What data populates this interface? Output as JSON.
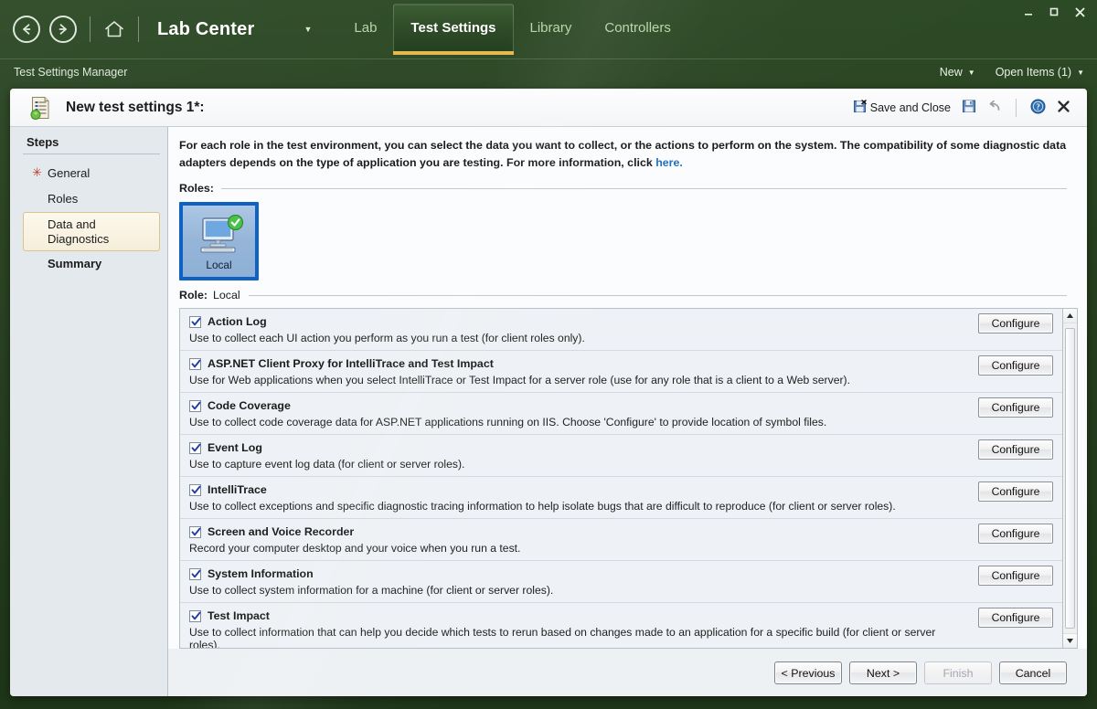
{
  "window": {
    "minimize_label": "minimize",
    "maximize_label": "maximize",
    "close_label": "close"
  },
  "nav": {
    "back_label": "Back",
    "forward_label": "Forward",
    "home_label": "Home",
    "brand": "Lab Center",
    "brand_caret": "▼",
    "tabs": [
      {
        "label": "Lab",
        "active": false
      },
      {
        "label": "Test Settings",
        "active": true
      },
      {
        "label": "Library",
        "active": false
      },
      {
        "label": "Controllers",
        "active": false
      }
    ]
  },
  "subbar": {
    "title": "Test Settings Manager",
    "new_label": "New",
    "open_items_label": "Open Items (1)",
    "caret": "▼"
  },
  "card": {
    "title": "New test settings 1*:",
    "actions": {
      "save_and_close": "Save and Close",
      "save": "Save",
      "undo": "Undo",
      "help": "Help",
      "close": "Close"
    }
  },
  "sidebar": {
    "heading": "Steps",
    "items": [
      {
        "label": "General",
        "required": true,
        "selected": false,
        "bold": false
      },
      {
        "label": "Roles",
        "required": false,
        "selected": false,
        "bold": false
      },
      {
        "label": "Data and Diagnostics",
        "required": false,
        "selected": true,
        "bold": false
      },
      {
        "label": "Summary",
        "required": false,
        "selected": false,
        "bold": true
      }
    ]
  },
  "main": {
    "intro_text": "For each role in the test environment, you can select the data you want to collect, or the actions to perform on the system. The compatibility of some diagnostic data adapters depends on the type of application you are testing. For more information, click ",
    "intro_link": "here.",
    "roles_legend": "Roles:",
    "roles": [
      {
        "label": "Local",
        "selected": true,
        "status": "ok"
      }
    ],
    "role_legend_label": "Role:",
    "role_legend_value": "Local",
    "configure_label": "Configure",
    "adapters": [
      {
        "name": "Action Log",
        "checked": true,
        "description": "Use to collect each UI action you perform as you run a test (for client roles only)."
      },
      {
        "name": "ASP.NET Client Proxy for IntelliTrace and Test Impact",
        "checked": true,
        "description": "Use for Web applications when you select IntelliTrace or Test Impact for a server role (use for any role that is a client to a Web server)."
      },
      {
        "name": "Code Coverage",
        "checked": true,
        "description": "Use to collect code coverage data for ASP.NET applications running on IIS. Choose 'Configure' to provide location of symbol files."
      },
      {
        "name": "Event Log",
        "checked": true,
        "description": "Use to capture event log data (for client or server roles)."
      },
      {
        "name": "IntelliTrace",
        "checked": true,
        "description": "Use to collect exceptions and specific diagnostic tracing information to help isolate bugs that are difficult to reproduce (for client or server roles)."
      },
      {
        "name": "Screen and Voice Recorder",
        "checked": true,
        "description": "Record your computer desktop and your voice when you run a test."
      },
      {
        "name": "System Information",
        "checked": true,
        "description": "Use to collect system information for a machine (for client or server roles)."
      },
      {
        "name": "Test Impact",
        "checked": true,
        "description": "Use to collect information that can help you decide which tests to rerun based on changes made to an application for a specific build (for client or server roles)."
      }
    ],
    "scrollbar": {
      "up": "▲",
      "down": "▼"
    }
  },
  "footer": {
    "buttons": [
      {
        "label": "< Previous",
        "disabled": false
      },
      {
        "label": "Next >",
        "disabled": false
      },
      {
        "label": "Finish",
        "disabled": true
      },
      {
        "label": "Cancel",
        "disabled": false
      }
    ]
  },
  "colors": {
    "chrome_green": "#2d4a26",
    "tab_accent": "#e5b94e",
    "link": "#1f6fc4",
    "selection_blue": "#0f62c4",
    "status_green": "#3fae3f",
    "required_red": "#c0392b"
  }
}
